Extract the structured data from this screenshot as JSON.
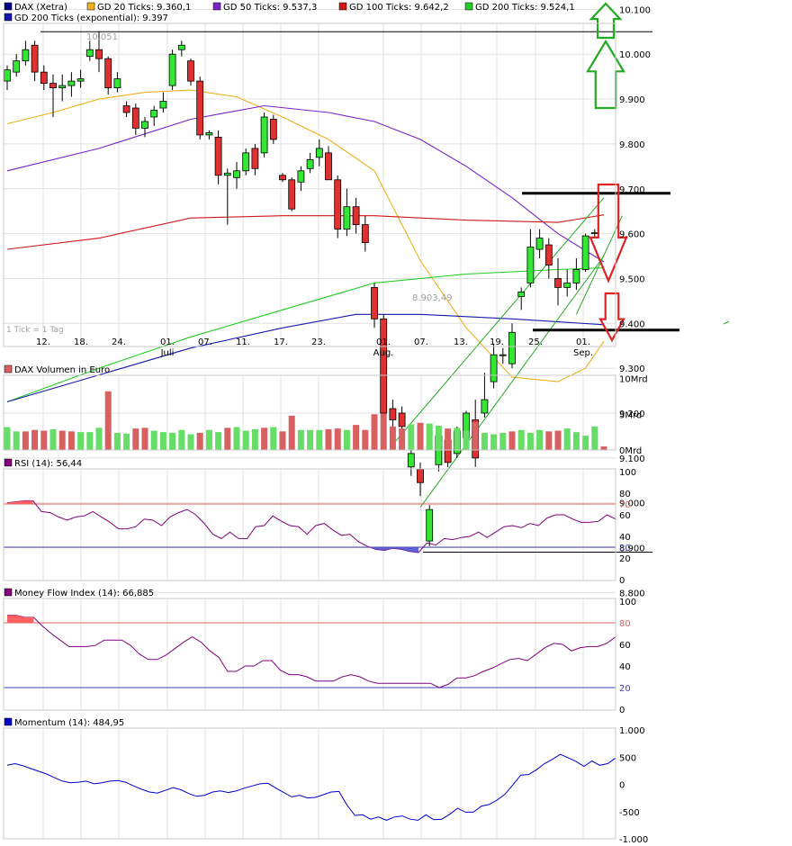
{
  "colors": {
    "candle_up": "#33e833",
    "candle_down": "#e03030",
    "gd20": "#f0b020",
    "gd50": "#7a22c8",
    "gd100": "#d01818",
    "gd200": "#22cc22",
    "gd200exp": "#1818b0",
    "channel": "#22aa22",
    "vol_up": "#66dd66",
    "vol_down": "#d86060",
    "osc_line": "#800080",
    "mom_line": "#0000cc",
    "level_red": "#e06060",
    "level_blue": "#4040c0",
    "grid": "#e0e0e0",
    "arrow_green": "#22aa22",
    "arrow_red": "#dd2222"
  },
  "legend": {
    "row1": [
      {
        "key": "price",
        "color": "#000080",
        "label": "DAX (Xetra)"
      },
      {
        "key": "gd20",
        "color": "#f0b020",
        "label": "GD 20 Ticks: 9.360,1"
      },
      {
        "key": "gd50",
        "color": "#7a22c8",
        "label": "GD 50 Ticks: 9.537,3"
      },
      {
        "key": "gd100",
        "color": "#d01818",
        "label": "GD 100 Ticks: 9.642,2"
      },
      {
        "key": "gd200",
        "color": "#22cc22",
        "label": "GD 200 Ticks: 9.524,1"
      }
    ],
    "row2": [
      {
        "key": "gd200exp",
        "color": "#1818b0",
        "label": "GD 200 Ticks (exponential): 9.397"
      }
    ]
  },
  "panels": {
    "volume_title": "DAX Volumen in Euro",
    "rsi_title": "RSI (14): 56,44",
    "mfi_title": "Money Flow Index (14): 66,885",
    "momentum_title": "Momentum (14): 484,95"
  },
  "tick_note": "1 Tick = 1 Tag",
  "x_axis": {
    "days": [
      "12.",
      "18.",
      "24.",
      "01.",
      "07.",
      "11.",
      "17.",
      "23.",
      "01.",
      "07.",
      "13.",
      "19.",
      "25.",
      "01."
    ],
    "months": [
      "Juli",
      "Aug.",
      "Sep."
    ]
  },
  "chart_data": [
    {
      "type": "candlestick",
      "title": "DAX (Xetra)",
      "y_ticks": [
        "10.100",
        "10.000",
        "9.900",
        "9.800",
        "9.700",
        "9.600",
        "9.500",
        "9.400",
        "9.300",
        "9.200",
        "9.100",
        "9.000",
        "8.900",
        "8.800"
      ],
      "ylim": [
        8750,
        10150
      ],
      "annotations": {
        "high_label": "10.051",
        "low_label": "8.903,49",
        "high": 10051,
        "low": 8903.49
      },
      "candles": [
        {
          "o": 9940,
          "h": 9975,
          "l": 9920,
          "c": 9965
        },
        {
          "o": 9960,
          "h": 10000,
          "l": 9950,
          "c": 9985
        },
        {
          "o": 9985,
          "h": 10030,
          "l": 9975,
          "c": 10010
        },
        {
          "o": 10020,
          "h": 10030,
          "l": 9940,
          "c": 9960
        },
        {
          "o": 9960,
          "h": 9975,
          "l": 9920,
          "c": 9935
        },
        {
          "o": 9935,
          "h": 9955,
          "l": 9860,
          "c": 9925
        },
        {
          "o": 9925,
          "h": 9955,
          "l": 9895,
          "c": 9930
        },
        {
          "o": 9930,
          "h": 9960,
          "l": 9905,
          "c": 9940
        },
        {
          "o": 9940,
          "h": 9965,
          "l": 9925,
          "c": 9945
        },
        {
          "o": 9995,
          "h": 10030,
          "l": 9985,
          "c": 10010
        },
        {
          "o": 10010,
          "h": 10051,
          "l": 9960,
          "c": 9990
        },
        {
          "o": 9990,
          "h": 9995,
          "l": 9910,
          "c": 9925
        },
        {
          "o": 9925,
          "h": 9960,
          "l": 9915,
          "c": 9945
        },
        {
          "o": 9885,
          "h": 9895,
          "l": 9860,
          "c": 9870
        },
        {
          "o": 9880,
          "h": 9890,
          "l": 9820,
          "c": 9835
        },
        {
          "o": 9835,
          "h": 9860,
          "l": 9815,
          "c": 9850
        },
        {
          "o": 9860,
          "h": 9885,
          "l": 9840,
          "c": 9875
        },
        {
          "o": 9880,
          "h": 9915,
          "l": 9870,
          "c": 9895
        },
        {
          "o": 9930,
          "h": 10010,
          "l": 9920,
          "c": 10000
        },
        {
          "o": 10010,
          "h": 10030,
          "l": 9995,
          "c": 10020
        },
        {
          "o": 9985,
          "h": 9990,
          "l": 9930,
          "c": 9940
        },
        {
          "o": 9940,
          "h": 9950,
          "l": 9810,
          "c": 9820
        },
        {
          "o": 9820,
          "h": 9830,
          "l": 9810,
          "c": 9825
        },
        {
          "o": 9815,
          "h": 9830,
          "l": 9710,
          "c": 9730
        },
        {
          "o": 9730,
          "h": 9745,
          "l": 9620,
          "c": 9735
        },
        {
          "o": 9725,
          "h": 9760,
          "l": 9700,
          "c": 9740
        },
        {
          "o": 9740,
          "h": 9790,
          "l": 9730,
          "c": 9780
        },
        {
          "o": 9790,
          "h": 9800,
          "l": 9730,
          "c": 9745
        },
        {
          "o": 9780,
          "h": 9870,
          "l": 9770,
          "c": 9860
        },
        {
          "o": 9855,
          "h": 9865,
          "l": 9800,
          "c": 9810
        },
        {
          "o": 9730,
          "h": 9735,
          "l": 9715,
          "c": 9720
        },
        {
          "o": 9720,
          "h": 9725,
          "l": 9650,
          "c": 9655
        },
        {
          "o": 9715,
          "h": 9750,
          "l": 9695,
          "c": 9740
        },
        {
          "o": 9745,
          "h": 9780,
          "l": 9735,
          "c": 9765
        },
        {
          "o": 9770,
          "h": 9810,
          "l": 9750,
          "c": 9790
        },
        {
          "o": 9780,
          "h": 9795,
          "l": 9730,
          "c": 9720
        },
        {
          "o": 9720,
          "h": 9730,
          "l": 9590,
          "c": 9610
        },
        {
          "o": 9610,
          "h": 9700,
          "l": 9595,
          "c": 9660
        },
        {
          "o": 9660,
          "h": 9680,
          "l": 9600,
          "c": 9620
        },
        {
          "o": 9620,
          "h": 9640,
          "l": 9560,
          "c": 9580
        },
        {
          "o": 9480,
          "h": 9490,
          "l": 9390,
          "c": 9410
        },
        {
          "o": 9410,
          "h": 9420,
          "l": 9190,
          "c": 9200
        },
        {
          "o": 9210,
          "h": 9230,
          "l": 9170,
          "c": 9185
        },
        {
          "o": 9200,
          "h": 9215,
          "l": 9120,
          "c": 9170
        },
        {
          "o": 9080,
          "h": 9120,
          "l": 9060,
          "c": 9110
        },
        {
          "o": 9075,
          "h": 9090,
          "l": 9015,
          "c": 9045
        },
        {
          "o": 8915,
          "h": 8995,
          "l": 8903.49,
          "c": 8985
        },
        {
          "o": 9085,
          "h": 9160,
          "l": 9070,
          "c": 9150
        },
        {
          "o": 9140,
          "h": 9160,
          "l": 9080,
          "c": 9090
        },
        {
          "o": 9110,
          "h": 9170,
          "l": 9100,
          "c": 9160
        },
        {
          "o": 9145,
          "h": 9205,
          "l": 9130,
          "c": 9200
        },
        {
          "o": 9185,
          "h": 9230,
          "l": 9080,
          "c": 9100
        },
        {
          "o": 9200,
          "h": 9290,
          "l": 9190,
          "c": 9230
        },
        {
          "o": 9270,
          "h": 9355,
          "l": 9255,
          "c": 9330
        },
        {
          "o": 9330,
          "h": 9345,
          "l": 9310,
          "c": 9330
        },
        {
          "o": 9310,
          "h": 9400,
          "l": 9300,
          "c": 9380
        },
        {
          "o": 9460,
          "h": 9480,
          "l": 9430,
          "c": 9470
        },
        {
          "o": 9490,
          "h": 9610,
          "l": 9480,
          "c": 9570
        },
        {
          "o": 9565,
          "h": 9610,
          "l": 9545,
          "c": 9590
        },
        {
          "o": 9575,
          "h": 9590,
          "l": 9500,
          "c": 9530
        },
        {
          "o": 9500,
          "h": 9545,
          "l": 9440,
          "c": 9480
        },
        {
          "o": 9480,
          "h": 9520,
          "l": 9460,
          "c": 9490
        },
        {
          "o": 9490,
          "h": 9545,
          "l": 9475,
          "c": 9520
        },
        {
          "o": 9520,
          "h": 9600,
          "l": 9515,
          "c": 9595
        },
        {
          "o": 9600,
          "h": 9610,
          "l": 9590,
          "c": 9602
        }
      ],
      "moving_averages": {
        "gd20": [
          [
            0,
            9845
          ],
          [
            5,
            9870
          ],
          [
            10,
            9900
          ],
          [
            15,
            9915
          ],
          [
            20,
            9920
          ],
          [
            25,
            9905
          ],
          [
            30,
            9860
          ],
          [
            35,
            9810
          ],
          [
            40,
            9740
          ],
          [
            45,
            9540
          ],
          [
            50,
            9390
          ],
          [
            55,
            9280
          ],
          [
            60,
            9270
          ],
          [
            63,
            9300
          ],
          [
            65,
            9360
          ]
        ],
        "gd50": [
          [
            0,
            9740
          ],
          [
            10,
            9790
          ],
          [
            20,
            9855
          ],
          [
            28,
            9885
          ],
          [
            35,
            9870
          ],
          [
            40,
            9850
          ],
          [
            45,
            9810
          ],
          [
            50,
            9750
          ],
          [
            55,
            9680
          ],
          [
            60,
            9600
          ],
          [
            65,
            9537
          ]
        ],
        "gd100": [
          [
            0,
            9565
          ],
          [
            10,
            9590
          ],
          [
            20,
            9635
          ],
          [
            30,
            9640
          ],
          [
            40,
            9640
          ],
          [
            50,
            9630
          ],
          [
            60,
            9625
          ],
          [
            65,
            9642
          ]
        ],
        "gd200": [
          [
            0,
            9225
          ],
          [
            10,
            9300
          ],
          [
            20,
            9370
          ],
          [
            30,
            9430
          ],
          [
            40,
            9490
          ],
          [
            50,
            9510
          ],
          [
            60,
            9520
          ],
          [
            65,
            9524
          ]
        ],
        "gd200exp": [
          [
            0,
            9225
          ],
          [
            10,
            9285
          ],
          [
            20,
            9345
          ],
          [
            30,
            9390
          ],
          [
            38,
            9420
          ],
          [
            45,
            9420
          ],
          [
            55,
            9410
          ],
          [
            65,
            9397
          ]
        ]
      },
      "horizontal_levels": [
        10050,
        9690,
        9385,
        8890
      ],
      "channel_lines": [
        {
          "from": [
            42,
            9130
          ],
          "to": [
            65,
            9680
          ]
        },
        {
          "from": [
            45,
            8990
          ],
          "to": [
            65,
            9550
          ]
        },
        {
          "from": [
            62,
            9420
          ],
          "to": [
            67,
            9640
          ]
        }
      ]
    },
    {
      "type": "bar",
      "title": "DAX Volumen in Euro",
      "y_ticks": [
        "10Mrd",
        "5Mrd",
        "0Mrd"
      ],
      "ylim": [
        0,
        10
      ],
      "values": [
        3.2,
        2.6,
        2.6,
        2.8,
        2.7,
        2.9,
        2.7,
        2.6,
        2.5,
        2.5,
        3.1,
        8.2,
        2.4,
        2.3,
        3.0,
        3.1,
        2.7,
        2.5,
        2.4,
        2.8,
        2.2,
        2.4,
        2.8,
        2.5,
        3.1,
        3.2,
        2.7,
        2.9,
        3.1,
        3.2,
        2.6,
        4.8,
        2.8,
        2.8,
        2.8,
        2.9,
        3.0,
        2.8,
        3.5,
        2.8,
        5.0,
        5.1,
        3.3,
        3.0,
        3.6,
        3.8,
        3.7,
        3.4,
        3.0,
        3.1,
        2.7,
        3.9,
        2.4,
        2.2,
        2.4,
        2.6,
        2.8,
        2.4,
        2.8,
        2.6,
        2.7,
        3.0,
        2.5,
        2.0,
        3.3,
        0.5
      ],
      "up": [
        1,
        1,
        0,
        0,
        0,
        1,
        0,
        0,
        1,
        1,
        1,
        0,
        1,
        1,
        0,
        0,
        1,
        1,
        1,
        1,
        1,
        0,
        1,
        1,
        0,
        1,
        1,
        1,
        0,
        1,
        0,
        0,
        1,
        1,
        1,
        0,
        0,
        1,
        0,
        0,
        0,
        0,
        0,
        0,
        1,
        0,
        1,
        1,
        0,
        1,
        1,
        0,
        1,
        1,
        1,
        0,
        1,
        1,
        1,
        0,
        0,
        1,
        1,
        1,
        1,
        0
      ]
    },
    {
      "type": "line",
      "title": "RSI (14)",
      "y_ticks": [
        "100",
        "80",
        "70",
        "60",
        "40",
        "30",
        "20",
        "0"
      ],
      "ylim": [
        0,
        100
      ],
      "reference_lines": [
        70,
        30
      ],
      "values": [
        71,
        72,
        73,
        73,
        63,
        62,
        58,
        55,
        58,
        59,
        63,
        58,
        53,
        47,
        47,
        49,
        56,
        55,
        50,
        58,
        62,
        65,
        60,
        52,
        42,
        38,
        44,
        38,
        38,
        49,
        50,
        59,
        54,
        50,
        49,
        42,
        50,
        52,
        46,
        41,
        42,
        35,
        31,
        28,
        27,
        29,
        28,
        26,
        25,
        34,
        32,
        38,
        37,
        39,
        40,
        44,
        39,
        44,
        49,
        50,
        48,
        52,
        50,
        57,
        60,
        60,
        56,
        53,
        53,
        54,
        60,
        56
      ]
    },
    {
      "type": "line",
      "title": "Money Flow Index (14)",
      "y_ticks": [
        "100",
        "80",
        "60",
        "40",
        "20",
        "0"
      ],
      "ylim": [
        0,
        100
      ],
      "reference_lines": [
        80,
        20
      ],
      "values": [
        87,
        87,
        85,
        85,
        77,
        70,
        64,
        58,
        58,
        58,
        59,
        64,
        64,
        64,
        59,
        51,
        46,
        46,
        50,
        56,
        62,
        67,
        62,
        54,
        48,
        35,
        35,
        40,
        40,
        45,
        45,
        36,
        32,
        32,
        30,
        26,
        26,
        26,
        30,
        32,
        30,
        26,
        24,
        24,
        24,
        24,
        24,
        24,
        24,
        20,
        23,
        29,
        29,
        31,
        35,
        38,
        42,
        46,
        47,
        45,
        51,
        57,
        61,
        60,
        54,
        57,
        58,
        58,
        61,
        67
      ]
    },
    {
      "type": "line",
      "title": "Momentum (14)",
      "y_ticks": [
        "1.000",
        "500",
        "0",
        "-500",
        "-1.000"
      ],
      "ylim": [
        -1000,
        1000
      ],
      "values": [
        350,
        380,
        340,
        290,
        240,
        190,
        120,
        60,
        30,
        40,
        60,
        10,
        30,
        60,
        70,
        40,
        -30,
        -90,
        -140,
        -160,
        -110,
        -60,
        -100,
        -170,
        -220,
        -200,
        -140,
        -120,
        -150,
        -120,
        -70,
        -30,
        10,
        20,
        -70,
        -150,
        -230,
        -200,
        -250,
        -240,
        -190,
        -140,
        -130,
        -380,
        -570,
        -560,
        -640,
        -600,
        -660,
        -600,
        -580,
        -640,
        -660,
        -560,
        -650,
        -640,
        -550,
        -440,
        -510,
        -510,
        -400,
        -370,
        -290,
        -180,
        -10,
        170,
        180,
        270,
        380,
        460,
        550,
        490,
        420,
        330,
        430,
        350,
        380,
        484.95
      ]
    }
  ]
}
